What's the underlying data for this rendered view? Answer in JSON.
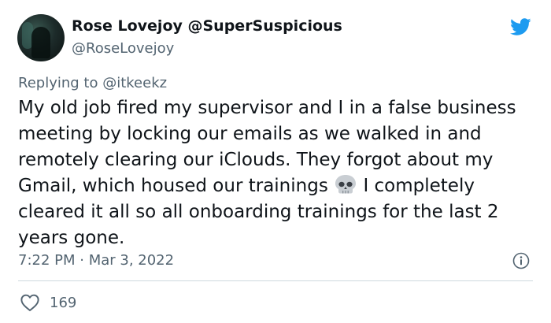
{
  "author": {
    "display_name": "Rose Lovejoy @SuperSuspicious",
    "handle": "@RoseLovejoy"
  },
  "reply": {
    "prefix": "Replying to",
    "mention": "@itkeekz"
  },
  "tweet": {
    "text_part1": "My old job fired my supervisor and I in a false business meeting by locking our emails as we walked in and remotely clearing our iClouds. They forgot about my Gmail, which housed our trainings",
    "emoji": "skull-emoji",
    "text_part2": "I completely cleared it all so all onboarding trainings for the last 2 years gone."
  },
  "meta": {
    "timestamp": "7:22 PM · Mar 3, 2022"
  },
  "engagement": {
    "likes": "169"
  },
  "icons": {
    "brand": "twitter-bird-icon",
    "info": "info-icon",
    "like": "heart-icon"
  },
  "colors": {
    "twitter_blue": "#1d9bf0",
    "secondary_text": "#536471",
    "primary_text": "#0f1419",
    "divider": "#cfd9de"
  }
}
